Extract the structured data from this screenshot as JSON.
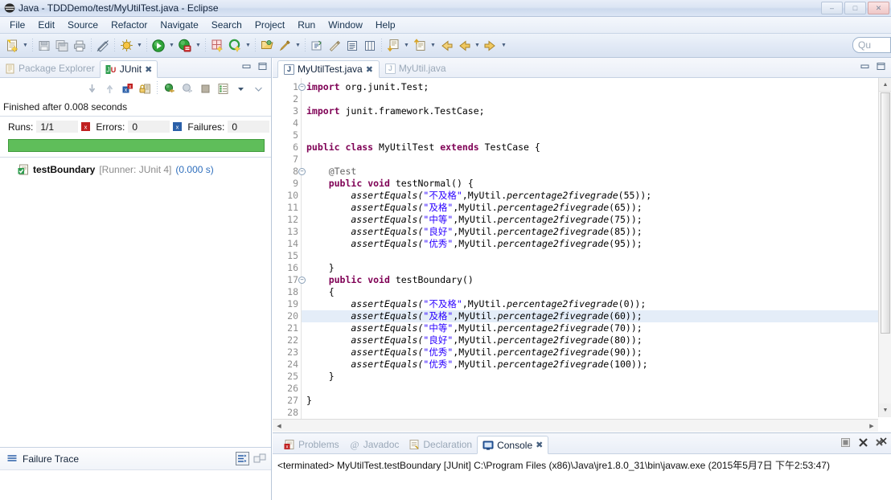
{
  "window": {
    "title": "Java - TDDDemo/test/MyUtilTest.java - Eclipse",
    "icon": "eclipse-icon",
    "minimize_label": "–",
    "maximize_label": "□",
    "close_label": "✕"
  },
  "menubar": {
    "items": [
      {
        "label": "File"
      },
      {
        "label": "Edit"
      },
      {
        "label": "Source"
      },
      {
        "label": "Refactor"
      },
      {
        "label": "Navigate"
      },
      {
        "label": "Search"
      },
      {
        "label": "Project"
      },
      {
        "label": "Run"
      },
      {
        "label": "Window"
      },
      {
        "label": "Help"
      }
    ]
  },
  "toolbar": {
    "quick_access_text": "Qu",
    "quick_access_placeholder": "Quick Access",
    "buttons": [
      {
        "name": "new-wizard-icon",
        "has_arrow": true
      },
      {
        "name": "save-icon",
        "has_arrow": false
      },
      {
        "name": "save-all-icon",
        "has_arrow": false
      },
      {
        "name": "print-icon",
        "has_arrow": false
      },
      {
        "name": "toggle-mark-occurrences-icon",
        "has_arrow": false
      },
      {
        "name": "debug-icon",
        "has_arrow": true
      },
      {
        "name": "run-icon",
        "has_arrow": true
      },
      {
        "name": "run-coverage-icon",
        "has_arrow": true
      },
      {
        "name": "new-java-package-icon",
        "has_arrow": false
      },
      {
        "name": "new-java-class-icon",
        "has_arrow": true
      },
      {
        "name": "open-type-icon",
        "has_arrow": false
      },
      {
        "name": "search-icon",
        "has_arrow": true
      },
      {
        "name": "toggle-breadcrumb-icon",
        "has_arrow": false
      },
      {
        "name": "last-edit-location-icon",
        "has_arrow": false
      },
      {
        "name": "show-whitespace-icon",
        "has_arrow": false
      },
      {
        "name": "show-source-icon",
        "has_arrow": false
      },
      {
        "name": "next-annotation-icon",
        "has_arrow": true
      },
      {
        "name": "previous-annotation-icon",
        "has_arrow": true
      },
      {
        "name": "back-icon",
        "has_arrow": false
      },
      {
        "name": "forward-icon",
        "has_arrow": true
      },
      {
        "name": "next-edit-icon",
        "has_arrow": true
      }
    ]
  },
  "junit_view": {
    "tabs": [
      {
        "label": "Package Explorer",
        "icon": "package-explorer-icon",
        "active": false,
        "closable": false
      },
      {
        "label": "JUnit",
        "icon": "junit-icon",
        "active": true,
        "closable": true
      }
    ],
    "close_glyph": "✖",
    "minimize_glyph": "━",
    "maximize_glyph": "❐",
    "toolbar_buttons": [
      {
        "name": "next-failure-icon"
      },
      {
        "name": "previous-failure-icon"
      },
      {
        "name": "show-failures-only-icon"
      },
      {
        "name": "lock-scroll-icon"
      },
      {
        "name": "rerun-test-icon"
      },
      {
        "name": "rerun-test-failures-icon"
      },
      {
        "name": "stop-icon"
      },
      {
        "name": "test-run-history-icon"
      },
      {
        "name": "view-menu-icon"
      },
      {
        "name": "minimize-view-icon"
      }
    ],
    "status_text": "Finished after 0.008 seconds",
    "counters": [
      {
        "label": "Runs:",
        "value": "1/1",
        "icon": null
      },
      {
        "label": "Errors:",
        "value": "0",
        "icon": "error-icon"
      },
      {
        "label": "Failures:",
        "value": "0",
        "icon": "failure-icon"
      }
    ],
    "progress": {
      "percent": 100,
      "color": "#5fbe5a"
    },
    "tree": [
      {
        "icon": "test-pass-icon",
        "name": "testBoundary",
        "runner": "[Runner: JUnit 4]",
        "time": "(0.000 s)"
      }
    ],
    "failure_trace": {
      "label": "Failure Trace",
      "icon": "failure-trace-icon",
      "buttons": [
        {
          "name": "filter-stack-trace-icon"
        },
        {
          "name": "compare-result-icon"
        }
      ]
    }
  },
  "editor": {
    "tabs": [
      {
        "label": "MyUtilTest.java",
        "icon": "java-file-icon",
        "active": true,
        "closable": true
      },
      {
        "label": "MyUtil.java",
        "icon": "java-file-icon",
        "active": false,
        "closable": false
      }
    ],
    "close_glyph": "✖",
    "minimize_glyph": "━",
    "maximize_glyph": "❐",
    "first_line": 1,
    "highlighted_line": 20,
    "fold_lines": [
      1,
      8,
      17
    ],
    "lines": [
      {
        "n": 1,
        "tokens": [
          {
            "t": "import",
            "c": "kw"
          },
          {
            "t": " org.junit.Test;",
            "c": ""
          }
        ]
      },
      {
        "n": 2,
        "tokens": []
      },
      {
        "n": 3,
        "tokens": [
          {
            "t": "import",
            "c": "kw"
          },
          {
            "t": " junit.framework.TestCase;",
            "c": ""
          }
        ]
      },
      {
        "n": 4,
        "tokens": []
      },
      {
        "n": 5,
        "tokens": []
      },
      {
        "n": 6,
        "tokens": [
          {
            "t": "public",
            "c": "kw"
          },
          {
            "t": " ",
            "c": ""
          },
          {
            "t": "class",
            "c": "kw"
          },
          {
            "t": " MyUtilTest ",
            "c": ""
          },
          {
            "t": "extends",
            "c": "kw"
          },
          {
            "t": " TestCase {",
            "c": ""
          }
        ]
      },
      {
        "n": 7,
        "tokens": []
      },
      {
        "n": 8,
        "tokens": [
          {
            "t": "    @Test",
            "c": "ann"
          }
        ]
      },
      {
        "n": 9,
        "tokens": [
          {
            "t": "    ",
            "c": ""
          },
          {
            "t": "public",
            "c": "kw"
          },
          {
            "t": " ",
            "c": ""
          },
          {
            "t": "void",
            "c": "kw"
          },
          {
            "t": " testNormal() {",
            "c": ""
          }
        ]
      },
      {
        "n": 10,
        "tokens": [
          {
            "t": "        assertEquals(",
            "c": "mth"
          },
          {
            "t": "\"不及格\"",
            "c": "str"
          },
          {
            "t": ",MyUtil.",
            "c": ""
          },
          {
            "t": "percentage2fivegrade",
            "c": "mth"
          },
          {
            "t": "(55));",
            "c": ""
          }
        ]
      },
      {
        "n": 11,
        "tokens": [
          {
            "t": "        assertEquals(",
            "c": "mth"
          },
          {
            "t": "\"及格\"",
            "c": "str"
          },
          {
            "t": ",MyUtil.",
            "c": ""
          },
          {
            "t": "percentage2fivegrade",
            "c": "mth"
          },
          {
            "t": "(65));",
            "c": ""
          }
        ]
      },
      {
        "n": 12,
        "tokens": [
          {
            "t": "        assertEquals(",
            "c": "mth"
          },
          {
            "t": "\"中等\"",
            "c": "str"
          },
          {
            "t": ",MyUtil.",
            "c": ""
          },
          {
            "t": "percentage2fivegrade",
            "c": "mth"
          },
          {
            "t": "(75));",
            "c": ""
          }
        ]
      },
      {
        "n": 13,
        "tokens": [
          {
            "t": "        assertEquals(",
            "c": "mth"
          },
          {
            "t": "\"良好\"",
            "c": "str"
          },
          {
            "t": ",MyUtil.",
            "c": ""
          },
          {
            "t": "percentage2fivegrade",
            "c": "mth"
          },
          {
            "t": "(85));",
            "c": ""
          }
        ]
      },
      {
        "n": 14,
        "tokens": [
          {
            "t": "        assertEquals(",
            "c": "mth"
          },
          {
            "t": "\"优秀\"",
            "c": "str"
          },
          {
            "t": ",MyUtil.",
            "c": ""
          },
          {
            "t": "percentage2fivegrade",
            "c": "mth"
          },
          {
            "t": "(95));",
            "c": ""
          }
        ]
      },
      {
        "n": 15,
        "tokens": []
      },
      {
        "n": 16,
        "tokens": [
          {
            "t": "    }",
            "c": ""
          }
        ]
      },
      {
        "n": 17,
        "tokens": [
          {
            "t": "    ",
            "c": ""
          },
          {
            "t": "public",
            "c": "kw"
          },
          {
            "t": " ",
            "c": ""
          },
          {
            "t": "void",
            "c": "kw"
          },
          {
            "t": " testBoundary()",
            "c": ""
          }
        ]
      },
      {
        "n": 18,
        "tokens": [
          {
            "t": "    {",
            "c": ""
          }
        ]
      },
      {
        "n": 19,
        "tokens": [
          {
            "t": "        assertEquals(",
            "c": "mth"
          },
          {
            "t": "\"不及格\"",
            "c": "str"
          },
          {
            "t": ",MyUtil.",
            "c": ""
          },
          {
            "t": "percentage2fivegrade",
            "c": "mth"
          },
          {
            "t": "(0));",
            "c": ""
          }
        ]
      },
      {
        "n": 20,
        "tokens": [
          {
            "t": "        assertEquals(",
            "c": "mth"
          },
          {
            "t": "\"及格\"",
            "c": "str"
          },
          {
            "t": ",MyUtil.",
            "c": ""
          },
          {
            "t": "percentage2fivegrade",
            "c": "mth"
          },
          {
            "t": "(60));",
            "c": ""
          }
        ]
      },
      {
        "n": 21,
        "tokens": [
          {
            "t": "        assertEquals(",
            "c": "mth"
          },
          {
            "t": "\"中等\"",
            "c": "str"
          },
          {
            "t": ",MyUtil.",
            "c": ""
          },
          {
            "t": "percentage2fivegrade",
            "c": "mth"
          },
          {
            "t": "(70));",
            "c": ""
          }
        ]
      },
      {
        "n": 22,
        "tokens": [
          {
            "t": "        assertEquals(",
            "c": "mth"
          },
          {
            "t": "\"良好\"",
            "c": "str"
          },
          {
            "t": ",MyUtil.",
            "c": ""
          },
          {
            "t": "percentage2fivegrade",
            "c": "mth"
          },
          {
            "t": "(80));",
            "c": ""
          }
        ]
      },
      {
        "n": 23,
        "tokens": [
          {
            "t": "        assertEquals(",
            "c": "mth"
          },
          {
            "t": "\"优秀\"",
            "c": "str"
          },
          {
            "t": ",MyUtil.",
            "c": ""
          },
          {
            "t": "percentage2fivegrade",
            "c": "mth"
          },
          {
            "t": "(90));",
            "c": ""
          }
        ]
      },
      {
        "n": 24,
        "tokens": [
          {
            "t": "        assertEquals(",
            "c": "mth"
          },
          {
            "t": "\"优秀\"",
            "c": "str"
          },
          {
            "t": ",MyUtil.",
            "c": ""
          },
          {
            "t": "percentage2fivegrade",
            "c": "mth"
          },
          {
            "t": "(100));",
            "c": ""
          }
        ]
      },
      {
        "n": 25,
        "tokens": [
          {
            "t": "    }",
            "c": ""
          }
        ]
      },
      {
        "n": 26,
        "tokens": []
      },
      {
        "n": 27,
        "tokens": [
          {
            "t": "}",
            "c": ""
          }
        ]
      },
      {
        "n": 28,
        "tokens": []
      }
    ]
  },
  "console": {
    "tabs": [
      {
        "label": "Problems",
        "icon": "problems-icon",
        "active": false,
        "closable": false
      },
      {
        "label": "Javadoc",
        "icon": "javadoc-icon",
        "active": false,
        "closable": false
      },
      {
        "label": "Declaration",
        "icon": "declaration-icon",
        "active": false,
        "closable": false
      },
      {
        "label": "Console",
        "icon": "console-icon",
        "active": true,
        "closable": true
      }
    ],
    "close_glyph": "✖",
    "buttons": [
      {
        "name": "terminate-icon"
      },
      {
        "name": "remove-launch-icon"
      },
      {
        "name": "remove-all-terminated-icon"
      }
    ],
    "output": "<terminated> MyUtilTest.testBoundary [JUnit] C:\\Program Files (x86)\\Java\\jre1.8.0_31\\bin\\javaw.exe (2015年5月7日 下午2:53:47)"
  },
  "colors": {
    "keyword": "#7f0055",
    "string": "#2a00ff",
    "comment": "#646464",
    "pass_green": "#5fbe5a",
    "highlight_line": "#e4edf8",
    "link_blue": "#2f6fbd"
  }
}
